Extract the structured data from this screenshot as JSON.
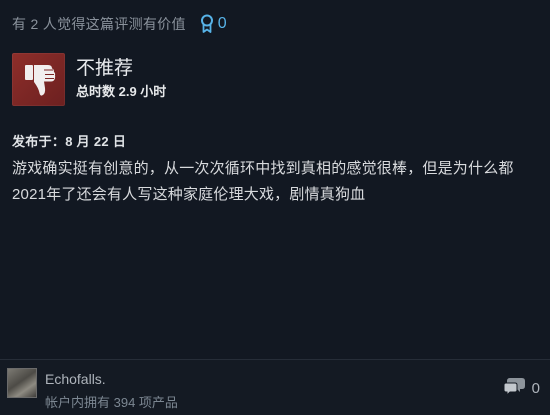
{
  "helpful": {
    "text": "有 2 人觉得这篇评测有价值",
    "award_icon": "award-ribbon-icon",
    "award_count": "0",
    "accent_color": "#57b3e8"
  },
  "verdict": {
    "icon": "thumbs-down-icon",
    "title": "不推荐",
    "hours": "总时数 2.9 小时",
    "color": "#8e2e2a"
  },
  "posted": "发布于：8 月 22 日",
  "review_text": "游戏确实挺有创意的，从一次次循环中找到真相的感觉很棒，但是为什么都2021年了还会有人写这种家庭伦理大戏，剧情真狗血",
  "author": {
    "name": "Echofalls.",
    "products": "帐户内拥有 394 项产品"
  },
  "comments": {
    "icon": "comment-bubble-icon",
    "count": "0"
  }
}
